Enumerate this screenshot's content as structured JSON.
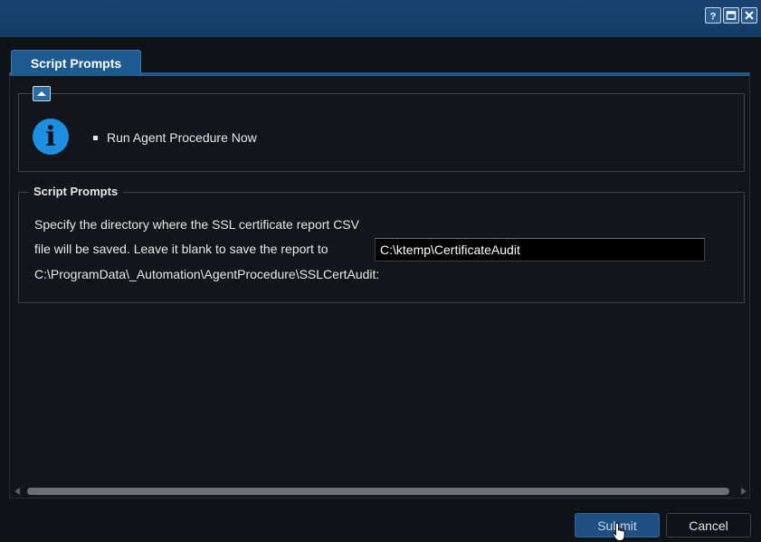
{
  "window": {
    "controls": [
      {
        "icon": "help-icon"
      },
      {
        "icon": "maximize-icon"
      },
      {
        "icon": "close-icon"
      }
    ]
  },
  "tab": {
    "label": "Script Prompts"
  },
  "info": {
    "icon": "info-icon",
    "bullet": "Run Agent Procedure Now"
  },
  "prompts": {
    "legend": "Script Prompts",
    "lines": [
      "Specify the directory where the SSL certificate report CSV",
      "file will be saved. Leave it blank to save the report to",
      "C:\\ProgramData\\_Automation\\AgentProcedure\\SSLCertAudit:"
    ],
    "input_value": "C:\\ktemp\\CertificateAudit"
  },
  "footer": {
    "submit_label": "Submit",
    "cancel_label": "Cancel"
  }
}
